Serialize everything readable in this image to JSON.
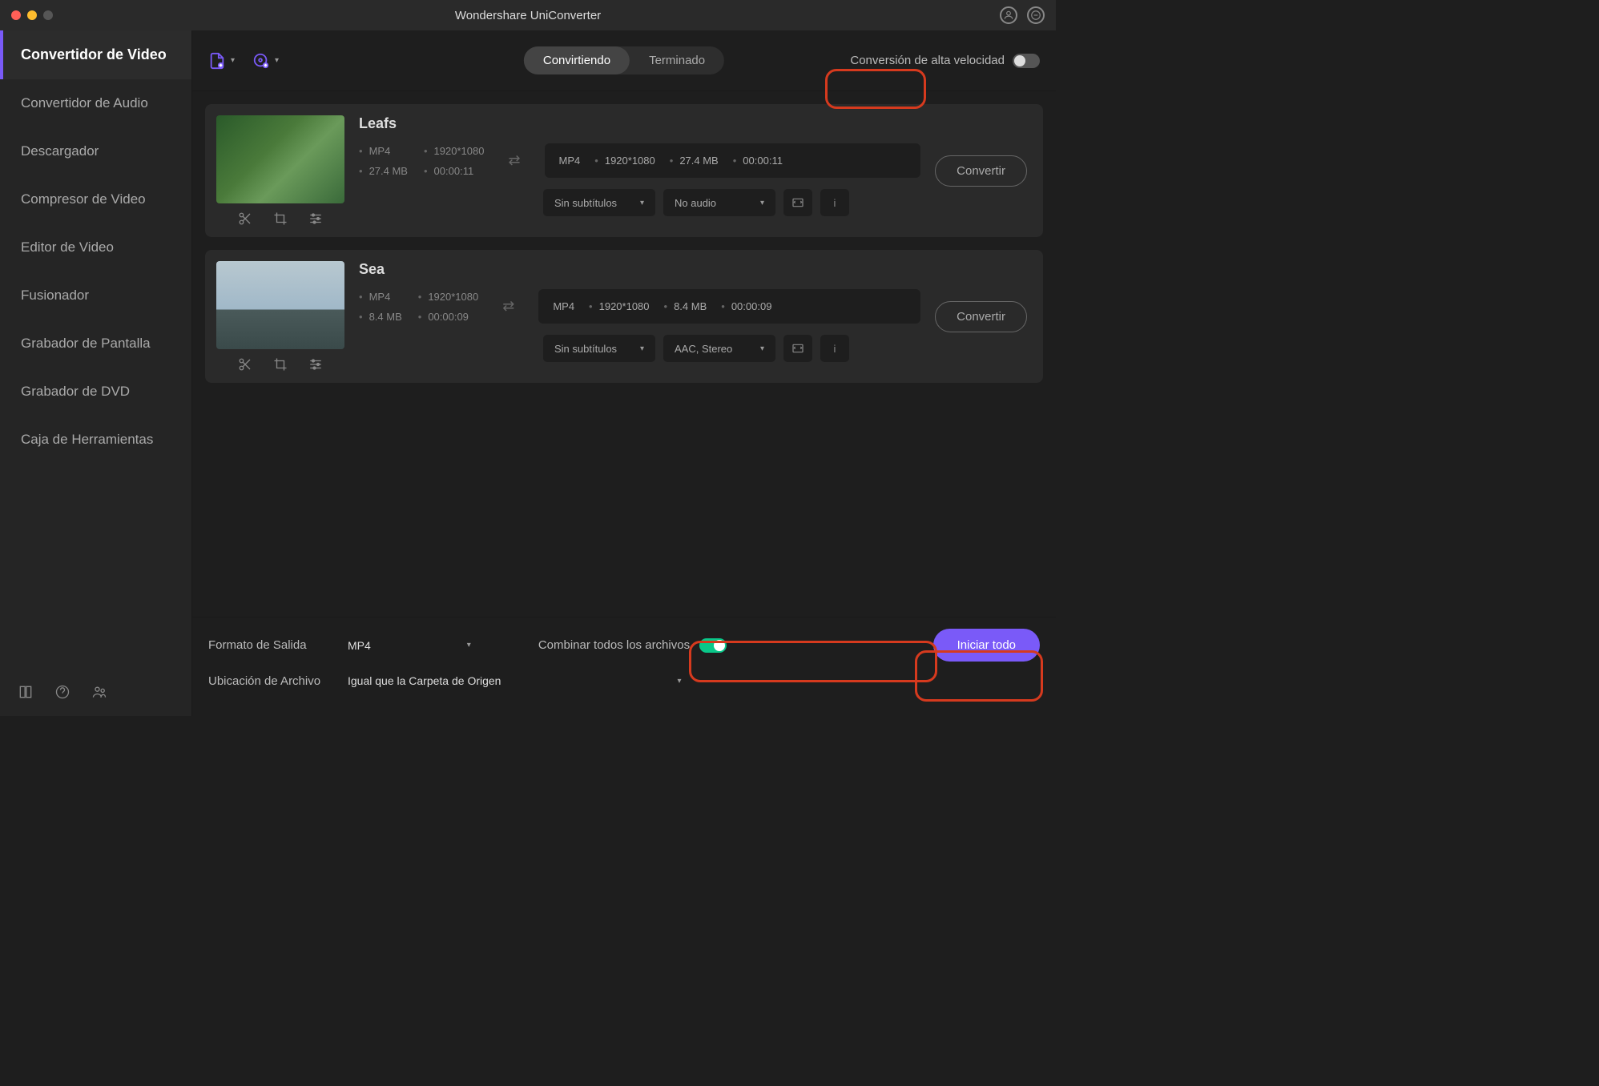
{
  "app_title": "Wondershare UniConverter",
  "sidebar": {
    "items": [
      {
        "label": "Convertidor de Video",
        "active": true
      },
      {
        "label": "Convertidor de Audio"
      },
      {
        "label": "Descargador"
      },
      {
        "label": "Compresor de Video"
      },
      {
        "label": "Editor de Video"
      },
      {
        "label": "Fusionador"
      },
      {
        "label": "Grabador de Pantalla"
      },
      {
        "label": "Grabador de DVD"
      },
      {
        "label": "Caja de Herramientas"
      }
    ]
  },
  "toolbar": {
    "tabs": {
      "converting": "Convirtiendo",
      "finished": "Terminado"
    },
    "high_speed_label": "Conversión de alta velocidad"
  },
  "files": [
    {
      "name": "Leafs",
      "src": {
        "format": "MP4",
        "resolution": "1920*1080",
        "size": "27.4 MB",
        "duration": "00:00:11"
      },
      "dst": {
        "format": "MP4",
        "resolution": "1920*1080",
        "size": "27.4 MB",
        "duration": "00:00:11"
      },
      "subtitle": "Sin subtítulos",
      "audio": "No audio",
      "convert_label": "Convertir"
    },
    {
      "name": "Sea",
      "src": {
        "format": "MP4",
        "resolution": "1920*1080",
        "size": "8.4 MB",
        "duration": "00:00:09"
      },
      "dst": {
        "format": "MP4",
        "resolution": "1920*1080",
        "size": "8.4 MB",
        "duration": "00:00:09"
      },
      "subtitle": "Sin subtítulos",
      "audio": "AAC, Stereo",
      "convert_label": "Convertir"
    }
  ],
  "footer": {
    "output_format_label": "Formato de Salida",
    "output_format_value": "MP4",
    "file_location_label": "Ubicación de Archivo",
    "file_location_value": "Igual que la Carpeta de Origen",
    "combine_label": "Combinar todos los archivos",
    "start_label": "Iniciar todo"
  }
}
